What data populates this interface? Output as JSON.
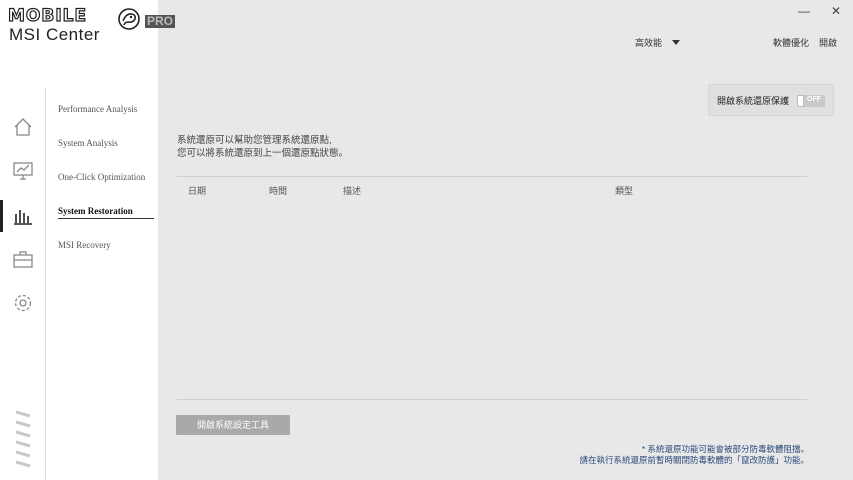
{
  "window": {
    "minimize_glyph": "—",
    "close_glyph": "✕"
  },
  "logo": {
    "brand_text": "MOBILE",
    "pro_text": "PRO",
    "app_name": "MSI Center"
  },
  "rail": {
    "icons": [
      "home-icon",
      "monitor-chart-icon",
      "bar-chart-icon",
      "toolbox-icon",
      "gear-icon"
    ],
    "active_index": 2
  },
  "nav": {
    "items": [
      {
        "label": "Performance Analysis"
      },
      {
        "label": "System Analysis"
      },
      {
        "label": "One-Click Optimization"
      },
      {
        "label": "System Restoration"
      },
      {
        "label": "MSI Recovery"
      }
    ],
    "active_index": 3
  },
  "header": {
    "mode_label": "高效能",
    "software_optimize": "軟體優化",
    "open": "開啟"
  },
  "restore_protection": {
    "label": "開啟系統還原保護",
    "toggle_text": "OFF",
    "enabled": false
  },
  "description": {
    "line1": "系統還原可以幫助您管理系統還原點,",
    "line2": "您可以將系統還原到上一個還原點狀態。"
  },
  "table": {
    "columns": [
      "日期",
      "時間",
      "描述",
      "類型"
    ],
    "rows": []
  },
  "actions": {
    "open_settings_tool": "開啟系統設定工具"
  },
  "footnote": {
    "line1": "* 系統還原功能可能會被部分防毒軟體阻擋。",
    "line2": "請在執行系統還原前暫時關閉防毒軟體的「竄改防護」功能。"
  },
  "colors": {
    "accent_dark": "#222222",
    "button_gray": "#a9a9a9",
    "note_blue": "#2c4a7c",
    "panel_bg": "#e8e8e8"
  }
}
